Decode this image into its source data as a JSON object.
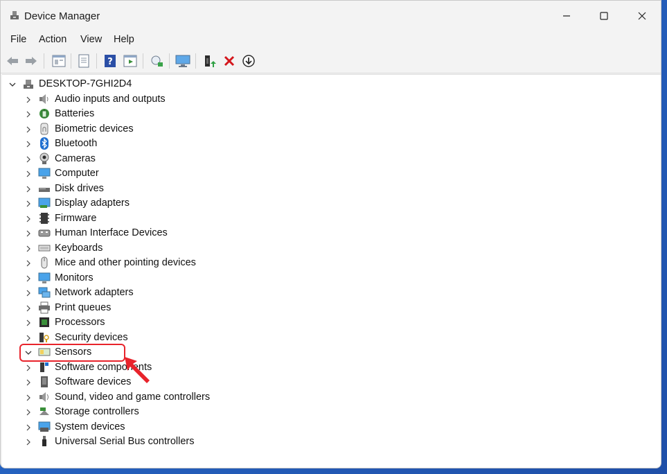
{
  "window": {
    "title": "Device Manager"
  },
  "menu": [
    "File",
    "Action",
    "View",
    "Help"
  ],
  "toolbar": {
    "buttons": [
      "back-icon",
      "forward-icon",
      "properties-icon",
      "refresh-list-icon",
      "help-icon",
      "show-hidden-icon",
      "scan-hardware-icon",
      "monitor-icon",
      "update-driver-icon",
      "uninstall-icon",
      "download-icon"
    ]
  },
  "tree": {
    "root": "DESKTOP-7GHI2D4",
    "items": [
      {
        "label": "Audio inputs and outputs",
        "icon": "speaker-icon"
      },
      {
        "label": "Batteries",
        "icon": "battery-icon"
      },
      {
        "label": "Biometric devices",
        "icon": "fingerprint-icon"
      },
      {
        "label": "Bluetooth",
        "icon": "bluetooth-icon"
      },
      {
        "label": "Cameras",
        "icon": "camera-icon"
      },
      {
        "label": "Computer",
        "icon": "computer-icon"
      },
      {
        "label": "Disk drives",
        "icon": "disk-icon"
      },
      {
        "label": "Display adapters",
        "icon": "display-adapter-icon"
      },
      {
        "label": "Firmware",
        "icon": "firmware-icon"
      },
      {
        "label": "Human Interface Devices",
        "icon": "hid-icon"
      },
      {
        "label": "Keyboards",
        "icon": "keyboard-icon"
      },
      {
        "label": "Mice and other pointing devices",
        "icon": "mouse-icon"
      },
      {
        "label": "Monitors",
        "icon": "monitor-icon"
      },
      {
        "label": "Network adapters",
        "icon": "network-icon"
      },
      {
        "label": "Print queues",
        "icon": "printer-icon"
      },
      {
        "label": "Processors",
        "icon": "processor-icon"
      },
      {
        "label": "Security devices",
        "icon": "security-icon"
      },
      {
        "label": "Sensors",
        "icon": "sensor-icon",
        "expanded": true
      },
      {
        "label": "Software components",
        "icon": "software-components-icon"
      },
      {
        "label": "Software devices",
        "icon": "software-devices-icon"
      },
      {
        "label": "Sound, video and game controllers",
        "icon": "sound-icon"
      },
      {
        "label": "Storage controllers",
        "icon": "storage-icon"
      },
      {
        "label": "System devices",
        "icon": "system-icon"
      },
      {
        "label": "Universal Serial Bus controllers",
        "icon": "usb-icon"
      }
    ]
  },
  "colors": {
    "highlight": "#e8232b",
    "accent": "#1f6fd0"
  }
}
